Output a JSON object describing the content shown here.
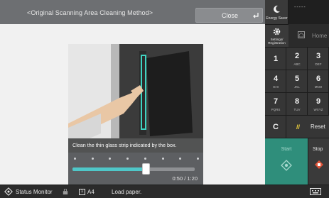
{
  "screen": {
    "title": "<Original Scanning Area Cleaning Method>",
    "close_label": "Close"
  },
  "video": {
    "caption": "Clean the thin glass strip indicated by the box.",
    "progress": 0.6,
    "time": "0:50 / 1:20",
    "dots": 8
  },
  "controls": {
    "prev": "skip-back-icon",
    "pause": "pause-icon",
    "next": "skip-forward-icon"
  },
  "status_bar": {
    "status_monitor": "Status Monitor",
    "paper": "A4",
    "paper_icon": "1",
    "message": "Load paper."
  },
  "panel": {
    "energy_saver": "Energy Saver",
    "dash": "-----",
    "settings": "Settings/\nRegistration",
    "home": "Home",
    "keys": [
      {
        "digit": "1",
        "sub": ""
      },
      {
        "digit": "2",
        "sub": "ABC"
      },
      {
        "digit": "3",
        "sub": "DEF"
      },
      {
        "digit": "4",
        "sub": "GHI"
      },
      {
        "digit": "5",
        "sub": "JKL"
      },
      {
        "digit": "6",
        "sub": "MNO"
      },
      {
        "digit": "7",
        "sub": "PQRS"
      },
      {
        "digit": "8",
        "sub": "TUV"
      },
      {
        "digit": "9",
        "sub": "WXYZ"
      },
      {
        "digit": "*",
        "sub": ""
      },
      {
        "digit": "0",
        "sub": ""
      },
      {
        "digit": "#",
        "sub": ""
      }
    ],
    "clear": "C",
    "reset": "Reset",
    "start": "Start",
    "stop": "Stop"
  },
  "colors": {
    "accent": "#4fc7c8",
    "start": "#2f8e7b",
    "stop": "#e0553a"
  }
}
